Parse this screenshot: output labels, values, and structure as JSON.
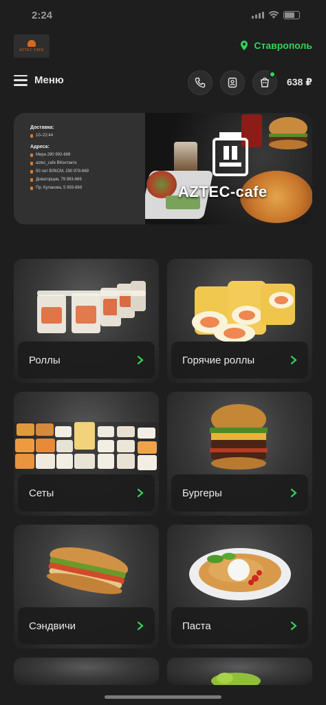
{
  "status_bar": {
    "time": "2:24"
  },
  "header": {
    "logo_text": "AZTEC CAFE",
    "city": "Ставрополь",
    "menu_label": "Меню",
    "cart_total": "638 ₽"
  },
  "banner": {
    "delivery_heading": "Доставка:",
    "delivery_hours": "10–22:44",
    "contacts_heading": "Адреса:",
    "contacts": [
      "Мира 290 992-669",
      "aztec_cafe ВКонтакте",
      "50 лет ВЛКСМ, 290 978-669",
      "Доваторцев, 79 993-669",
      "Пр. Кулакова, 5 993-669"
    ],
    "brand": "AZTEC-cafe"
  },
  "categories": [
    {
      "label": "Роллы"
    },
    {
      "label": "Горячие роллы"
    },
    {
      "label": "Сеты"
    },
    {
      "label": "Бургеры"
    },
    {
      "label": "Сэндвичи"
    },
    {
      "label": "Паста"
    }
  ],
  "colors": {
    "accent": "#31d659",
    "background": "#1e1e1e",
    "brand_orange": "#d46a1e"
  }
}
